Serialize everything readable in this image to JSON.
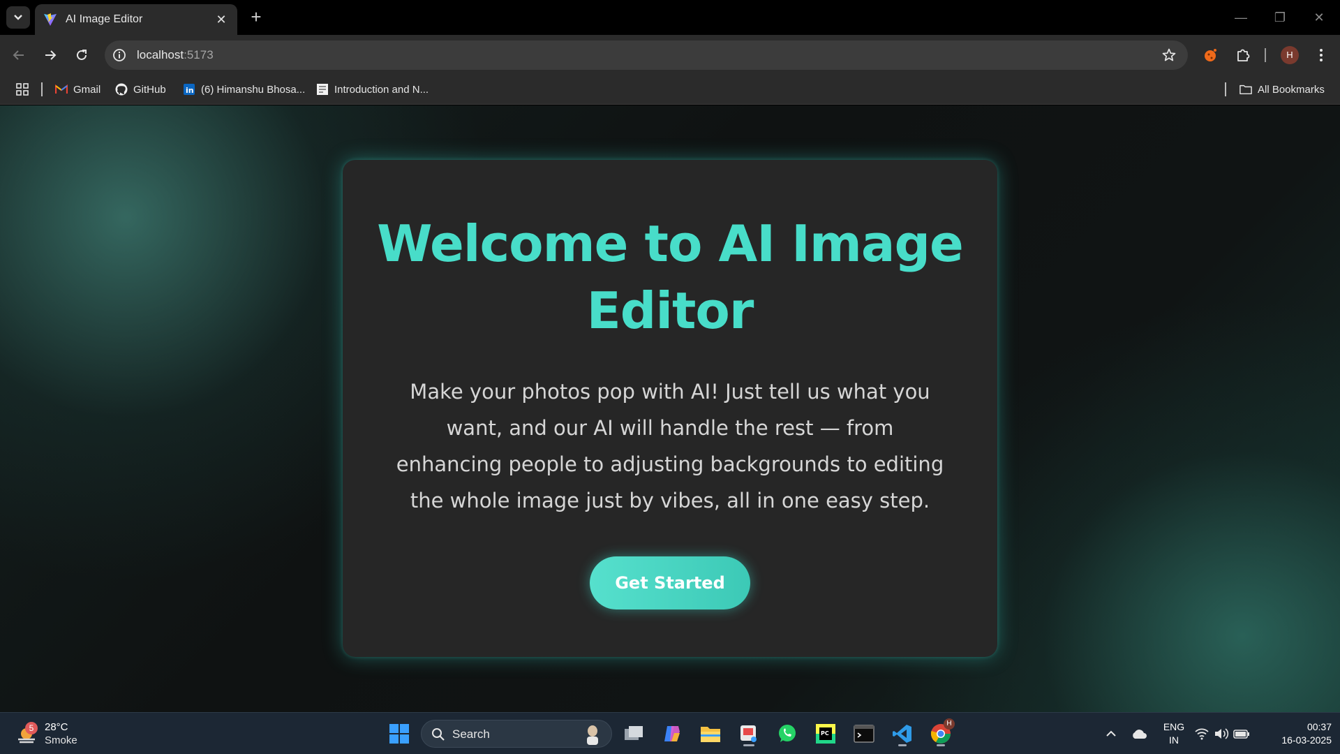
{
  "browser": {
    "tab": {
      "title": "AI Image Editor"
    },
    "address_bar": {
      "host": "localhost",
      "port": ":5173"
    },
    "profile_initial": "H",
    "bookmarks": [
      {
        "label": "Gmail",
        "icon": "gmail-icon"
      },
      {
        "label": "GitHub",
        "icon": "github-icon"
      },
      {
        "label": "(6) Himanshu Bhosa...",
        "icon": "linkedin-icon"
      },
      {
        "label": "Introduction and N...",
        "icon": "page-icon"
      }
    ],
    "all_bookmarks_label": "All Bookmarks"
  },
  "page": {
    "title": "Welcome to AI Image Editor",
    "description": "Make your photos pop with AI! Just tell us what you want, and our AI will handle the rest — from enhancing people to adjusting backgrounds to editing the whole image just by vibes, all in one easy step.",
    "cta_label": "Get Started",
    "accent_color": "#48ddc9"
  },
  "taskbar": {
    "weather": {
      "temp": "28°C",
      "condition": "Smoke",
      "badge": "5"
    },
    "search_label": "Search",
    "language": {
      "line1": "ENG",
      "line2": "IN"
    },
    "clock": {
      "time": "00:37",
      "date": "16-03-2025"
    }
  }
}
